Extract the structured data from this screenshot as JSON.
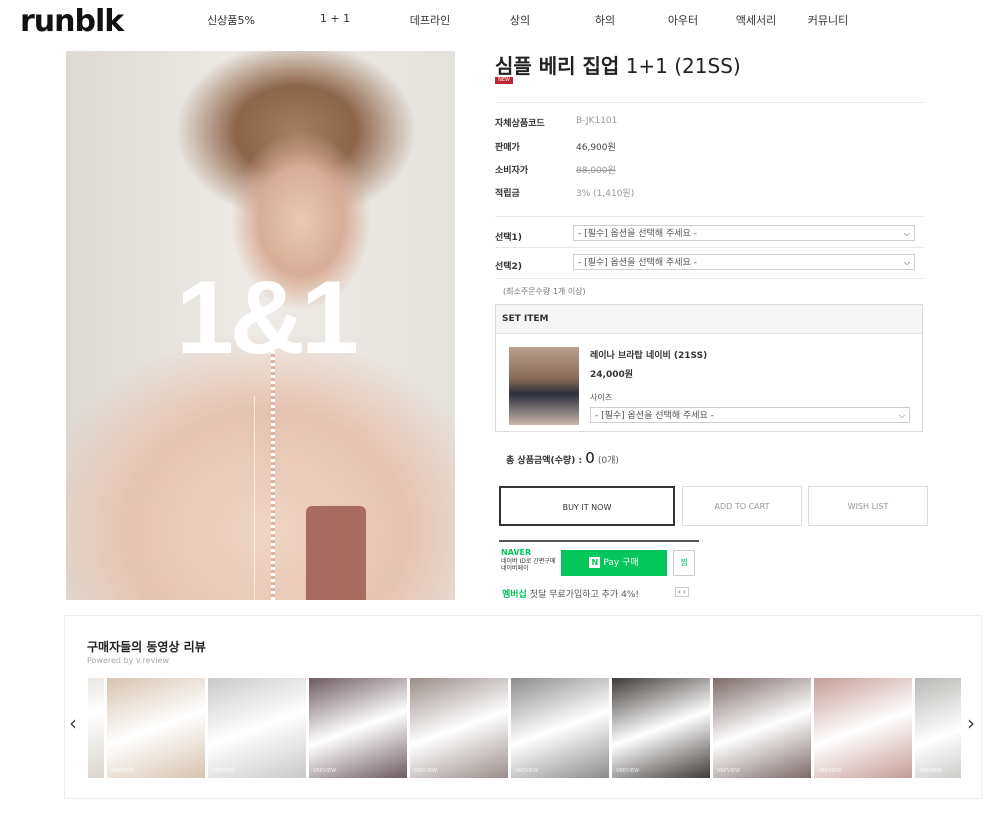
{
  "nav": {
    "logo": "runblk",
    "menu": [
      "신상품5%",
      "1 + 1",
      "데프라인",
      "상의",
      "하의",
      "아우터",
      "액세서리",
      "커뮤니티"
    ]
  },
  "hero": {
    "badge_text": "1&1"
  },
  "product": {
    "title_main": "심플 베리 집업",
    "title_suffix": "1+1 (21SS)",
    "new_tag": "NEW",
    "info": [
      {
        "label": "자체상품코드",
        "value": "B-JK1101"
      },
      {
        "label": "판매가",
        "value": "46,900원"
      },
      {
        "label": "소비자가",
        "value": "88,000원"
      },
      {
        "label": "적립금",
        "value": "3% (1,410원)"
      }
    ],
    "options": [
      {
        "label": "선택1)",
        "placeholder": "- [필수] 옵션을 선택해 주세요 -"
      },
      {
        "label": "선택2)",
        "placeholder": "- [필수] 옵션을 선택해 주세요 -"
      }
    ],
    "min_order_note": "(최소주문수량 1개 이상)"
  },
  "set_item": {
    "header": "SET ITEM",
    "name": "레이나 브라탑 네이비 (21SS)",
    "price": "24,000원",
    "size_label": "사이즈",
    "size_placeholder": "- [필수] 옵션을 선택해 주세요 -"
  },
  "total": {
    "label": "총 상품금액(수량) :",
    "amount": "0",
    "count": "(0개)"
  },
  "buttons": {
    "buy_now": "BUY IT NOW",
    "add_to_cart": "ADD TO CART",
    "wish_list": "WISH LIST"
  },
  "naver": {
    "logo": "NAVER",
    "sub": "네이버 ID로 간편구매 네이버페이",
    "pay_n": "N",
    "pay_label": "Pay 구매",
    "wish": "찜"
  },
  "membership": {
    "highlight": "멤버십",
    "text": " 첫달 무료가입하고 추가 4%!",
    "arrows": "‹ ›"
  },
  "review": {
    "title": "구매자들의 동영상 리뷰",
    "subtitle": "Powered by v.review",
    "watermark": "VREVIEW",
    "thumb_colors": [
      "#d9d4cc",
      "#d7c3b0",
      "#c9c9c9",
      "#6d5a60",
      "#9a8d89",
      "#8c8c8c",
      "#3f3b38",
      "#7c6a68",
      "#c49c96",
      "#b9b8b6"
    ]
  }
}
